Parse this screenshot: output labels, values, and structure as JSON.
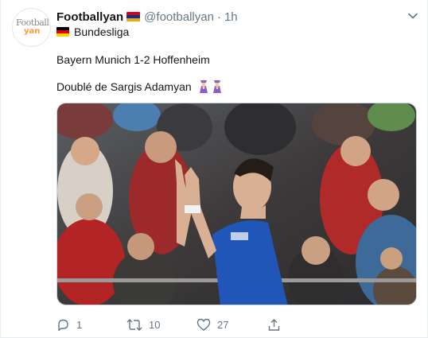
{
  "tweet": {
    "author_name": "Footballyan",
    "author_handle": "@footballyan",
    "separator": "·",
    "time": "1h",
    "author_flag_icon": "armenia-flag-icon",
    "league_flag_icon": "germany-flag-icon",
    "league": "Bundesliga",
    "line1": "Bayern Munich 1-2 Hoffenheim",
    "line2": "Doublé de Sargis Adamyan",
    "avatar_logo_top": "Football",
    "avatar_logo_bottom": "yan",
    "emoji_icon": "woman-mage-icon"
  },
  "actions": {
    "reply_count": "1",
    "retweet_count": "10",
    "like_count": "27"
  },
  "colors": {
    "text": "#14171a",
    "muted": "#657786",
    "armenia_flag": [
      "#d90012",
      "#0033a0",
      "#f2a800"
    ],
    "germany_flag": [
      "#000000",
      "#dd0000",
      "#ffce00"
    ]
  }
}
